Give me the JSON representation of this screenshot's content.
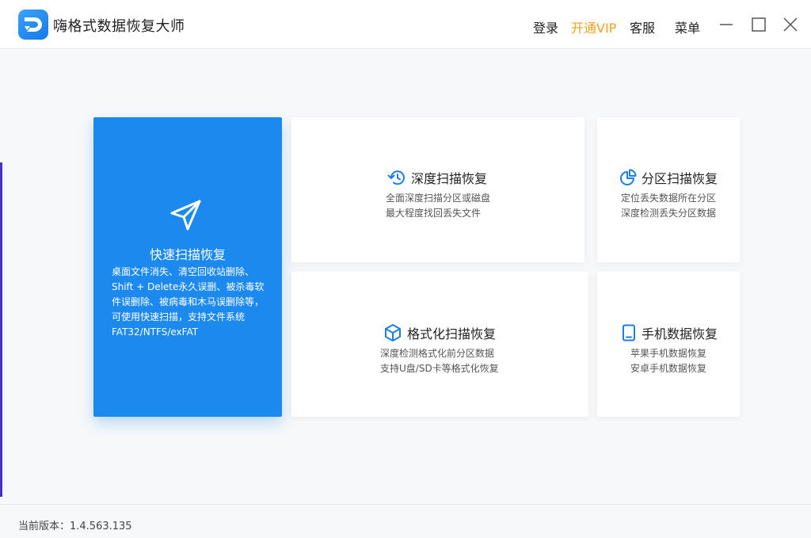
{
  "app": {
    "title": "嗨格式数据恢复大师"
  },
  "nav": {
    "login": "登录",
    "vip": "开通VIP",
    "service": "客服",
    "menu": "菜单"
  },
  "colors": {
    "accent": "#1c89ee",
    "vip": "#f2a11a",
    "background": "#f7f8fa"
  },
  "cards": {
    "quick": {
      "title": "快速扫描恢复",
      "icon": "paper-plane-icon",
      "desc": [
        "桌面文件消失、清空回收站删除、",
        "Shift + Delete永久误删、被杀毒软",
        "件误删除、被病毒和木马误删除等，",
        "可使用快速扫描，支持文件系统",
        "FAT32/NTFS/exFAT"
      ]
    },
    "deep": {
      "title": "深度扫描恢复",
      "icon": "history-icon",
      "desc": [
        "全面深度扫描分区或磁盘",
        "最大程度找回丢失文件"
      ]
    },
    "partition": {
      "title": "分区扫描恢复",
      "icon": "pie-chart-icon",
      "desc": [
        "定位丢失数据所在分区",
        "深度检测丢失分区数据"
      ]
    },
    "format": {
      "title": "格式化扫描恢复",
      "icon": "cube-icon",
      "desc": [
        "深度检测格式化前分区数据",
        "支持U盘/SD卡等格式化恢复"
      ]
    },
    "phone": {
      "title": "手机数据恢复",
      "icon": "phone-icon",
      "desc": [
        "苹果手机数据恢复",
        "安卓手机数据恢复"
      ]
    }
  },
  "footer": {
    "version": "当前版本：1.4.563.135"
  }
}
